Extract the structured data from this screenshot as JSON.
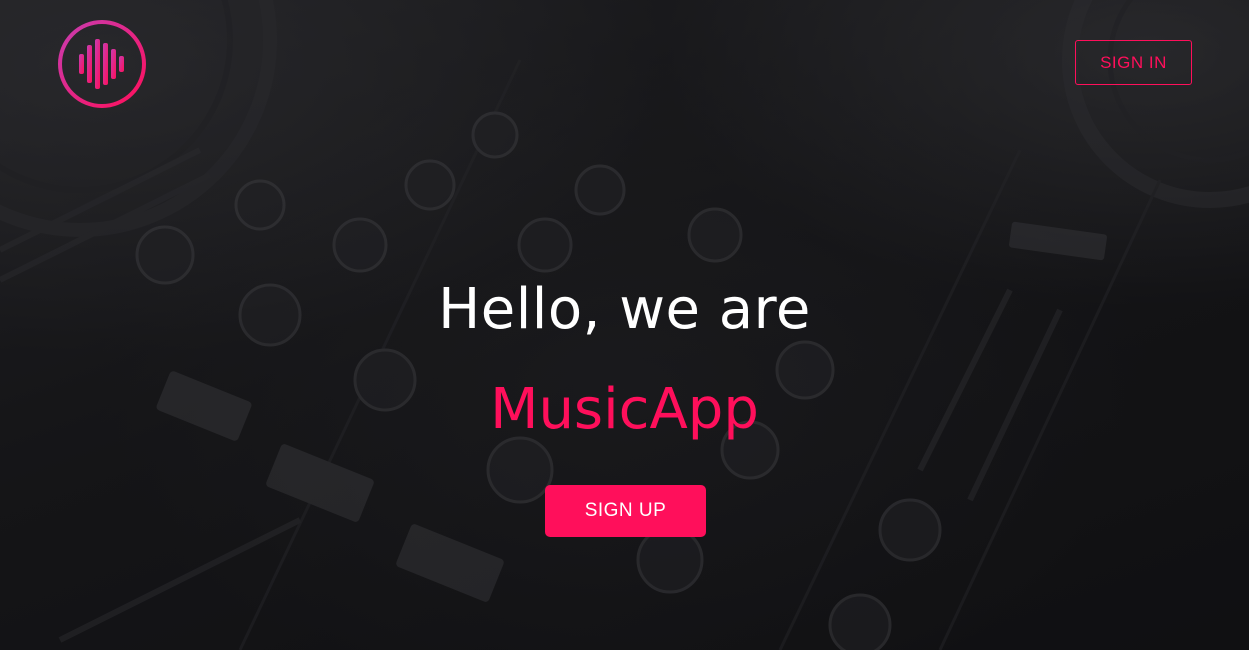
{
  "header": {
    "logo_icon": "sound-wave-logo-icon",
    "sign_in_label": "SIGN IN"
  },
  "hero": {
    "headline": "Hello, we are",
    "brand_name": "MusicApp",
    "sign_up_label": "SIGN UP",
    "background_image": "dj-mixer-console-photo"
  },
  "colors": {
    "accent": "#ff0f5b",
    "accent_gradient_end": "#c83cb0",
    "text": "#ffffff",
    "background": "#1b1b1d"
  }
}
